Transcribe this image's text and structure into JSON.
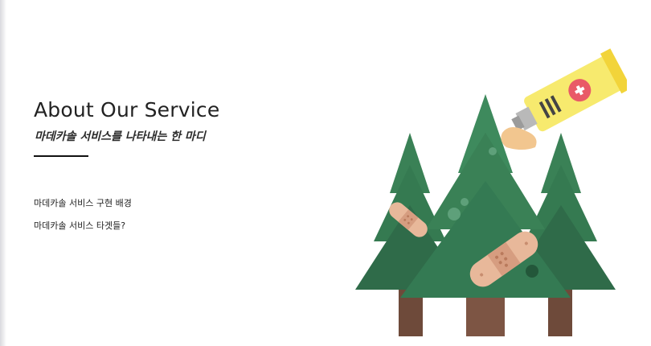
{
  "section": {
    "title": "About Our Service",
    "subtitle": "마데카솔 서비스를 나타내는 한 마디"
  },
  "links": [
    {
      "label": "마데카솔 서비스 구현 배경"
    },
    {
      "label": "마데카솔 서비스 타겟들?"
    }
  ],
  "colors": {
    "tree_dark": "#2f6b49",
    "tree_light": "#3e8a5d",
    "trunk": "#6e4a3a",
    "tube": "#f7ea6e",
    "bandage": "#e8b89a"
  },
  "illustration": {
    "icons": [
      "tree-icon",
      "bandage-icon",
      "ointment-tube-icon"
    ]
  }
}
